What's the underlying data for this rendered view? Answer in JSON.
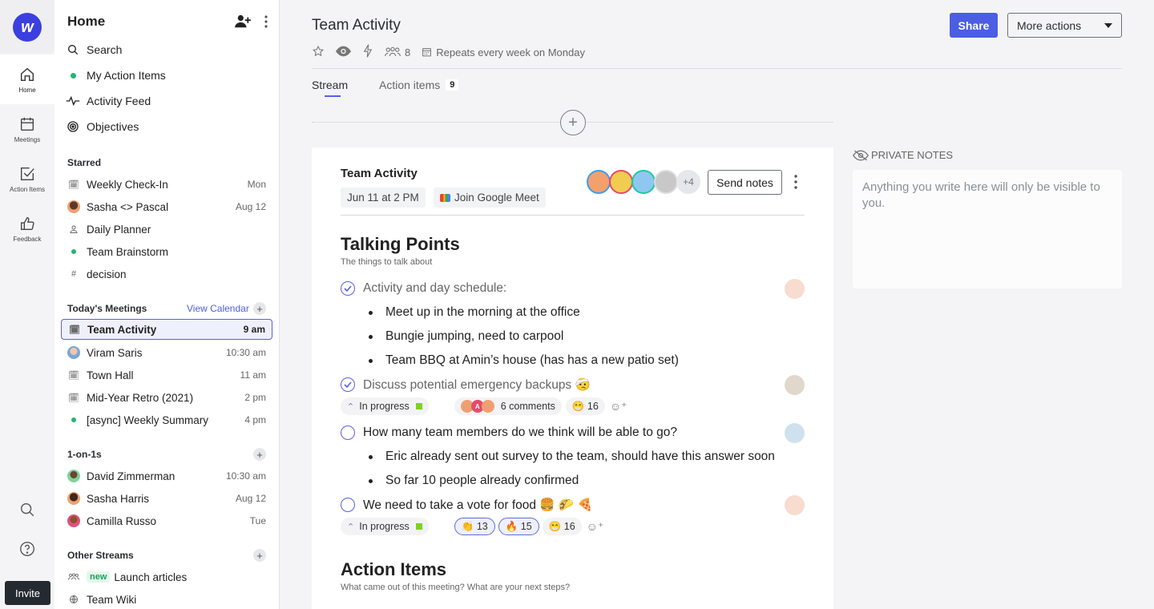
{
  "rail": {
    "logo": "w",
    "items": [
      {
        "label": "Home",
        "icon": "home-icon",
        "active": true
      },
      {
        "label": "Meetings",
        "icon": "calendar-icon"
      },
      {
        "label": "Action Items",
        "icon": "checkbox-icon"
      },
      {
        "label": "Feedback",
        "icon": "thumbs-up-icon"
      }
    ],
    "invite_label": "Invite"
  },
  "sidebar": {
    "title": "Home",
    "nav": [
      {
        "label": "Search",
        "icon": "search-icon"
      },
      {
        "label": "My Action Items",
        "icon": "green-dot-icon"
      },
      {
        "label": "Activity Feed",
        "icon": "pulse-icon"
      },
      {
        "label": "Objectives",
        "icon": "target-icon"
      }
    ],
    "starred": {
      "heading": "Starred",
      "items": [
        {
          "label": "Weekly Check-In",
          "meta": "Mon",
          "icon": "calendar-icon"
        },
        {
          "label": "Sasha <> Pascal",
          "meta": "Aug 12",
          "icon": "avatar"
        },
        {
          "label": "Daily Planner",
          "meta": "",
          "icon": "person-icon"
        },
        {
          "label": "Team Brainstorm",
          "meta": "",
          "icon": "green-dot-icon"
        },
        {
          "label": "decision",
          "meta": "",
          "icon": "hash-icon"
        }
      ]
    },
    "today": {
      "heading": "Today's Meetings",
      "link": "View Calendar",
      "items": [
        {
          "label": "Team Activity",
          "meta": "9 am",
          "icon": "calendar-icon",
          "selected": true
        },
        {
          "label": "Viram Saris",
          "meta": "10:30 am",
          "icon": "avatar"
        },
        {
          "label": "Town Hall",
          "meta": "11 am",
          "icon": "calendar-icon"
        },
        {
          "label": "Mid-Year Retro (2021)",
          "meta": "2 pm",
          "icon": "calendar-icon"
        },
        {
          "label": "[async] Weekly Summary",
          "meta": "4 pm",
          "icon": "green-dot-icon"
        }
      ]
    },
    "one_on_ones": {
      "heading": "1-on-1s",
      "items": [
        {
          "label": "David Zimmerman",
          "meta": "10:30 am"
        },
        {
          "label": "Sasha Harris",
          "meta": "Aug 12"
        },
        {
          "label": "Camilla Russo",
          "meta": "Tue"
        }
      ]
    },
    "other": {
      "heading": "Other Streams",
      "items": [
        {
          "label": "Launch articles",
          "badge": "new",
          "icon": "group-icon"
        },
        {
          "label": "Team Wiki",
          "icon": "globe-icon"
        }
      ]
    }
  },
  "header": {
    "title": "Team Activity",
    "attendees_count": "8",
    "recurrence": "Repeats every week on Monday",
    "share_label": "Share",
    "more_label": "More actions"
  },
  "tabs": [
    {
      "label": "Stream",
      "active": true
    },
    {
      "label": "Action items",
      "count": "9"
    }
  ],
  "meeting": {
    "title": "Team Activity",
    "date": "Jun 11 at 2 PM",
    "meet_label": "Join Google Meet",
    "extra_attendees": "+4",
    "send_notes_label": "Send notes",
    "talking_points": {
      "title": "Talking Points",
      "subtitle": "The things to talk about",
      "items": [
        {
          "text": "Activity and day schedule:",
          "done": true,
          "bullets": [
            "Meet up in the morning at the office",
            "Bungie jumping, need to carpool",
            "Team BBQ at Amin’s house (has has a new patio set)"
          ]
        },
        {
          "text": "Discuss potential emergency backups 🤕",
          "done": true,
          "status": "In progress",
          "comments": "6 comments",
          "reactions": [
            {
              "emoji": "😁",
              "count": "16"
            }
          ]
        },
        {
          "text": "How many team members do we think will be able to go?",
          "done": false,
          "bullets": [
            "Eric already sent out survey to the team, should have this answer soon",
            "So far 10 people already confirmed"
          ]
        },
        {
          "text": "We need to take a vote for food 🍔 🌮 🍕",
          "done": false,
          "status": "In progress",
          "reactions": [
            {
              "emoji": "👏",
              "count": "13"
            },
            {
              "emoji": "🔥",
              "count": "15"
            },
            {
              "emoji": "😁",
              "count": "16"
            }
          ]
        }
      ]
    },
    "action_items": {
      "title": "Action Items",
      "subtitle": "What came out of this meeting? What are your next steps?"
    }
  },
  "private_notes": {
    "heading": "PRIVATE NOTES",
    "placeholder": "Anything you write here will only be visible to you."
  },
  "colors": {
    "accent": "#4b5ee4",
    "green": "#22b573"
  }
}
